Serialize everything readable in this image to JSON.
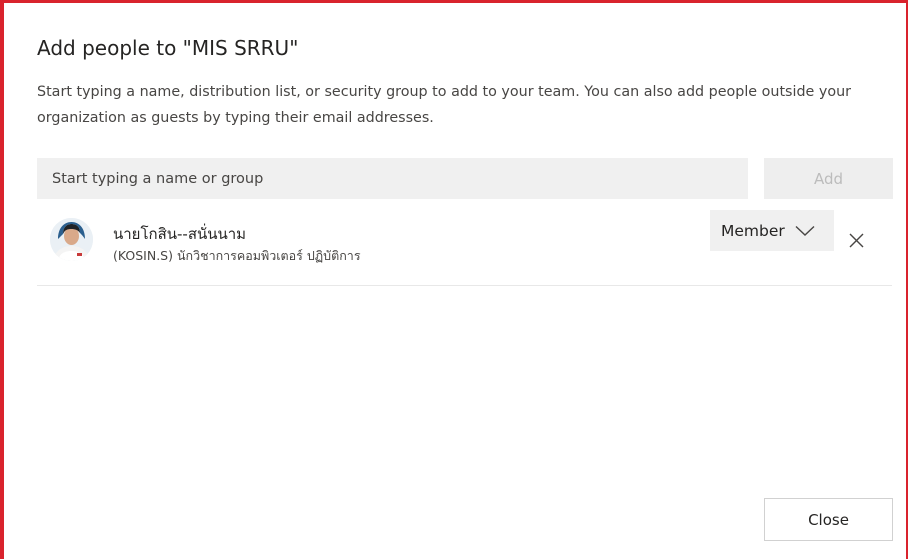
{
  "dialog": {
    "title": "Add people to \"MIS SRRU\"",
    "description": "Start typing a name, distribution list, or security group to add to your team. You can also add people outside your organization as guests by typing their email addresses."
  },
  "search": {
    "placeholder": "Start typing a name or group",
    "value": ""
  },
  "add_button": {
    "label": "Add",
    "enabled": false
  },
  "people": [
    {
      "name": "นายโกสิน--สนั่นนาม",
      "subtitle": "(KOSIN.S) นักวิชาการคอมพิวเตอร์ ปฏิบัติการ",
      "role": "Member"
    }
  ],
  "close_button": {
    "label": "Close"
  },
  "colors": {
    "frame_border": "#d9232d",
    "input_background": "#f0f0f0",
    "disabled_text": "#bcbcbc",
    "text_primary": "#252423"
  },
  "icons": {
    "avatar": "user-photo",
    "role_chevron": "chevron-down-icon",
    "remove": "close-icon"
  }
}
